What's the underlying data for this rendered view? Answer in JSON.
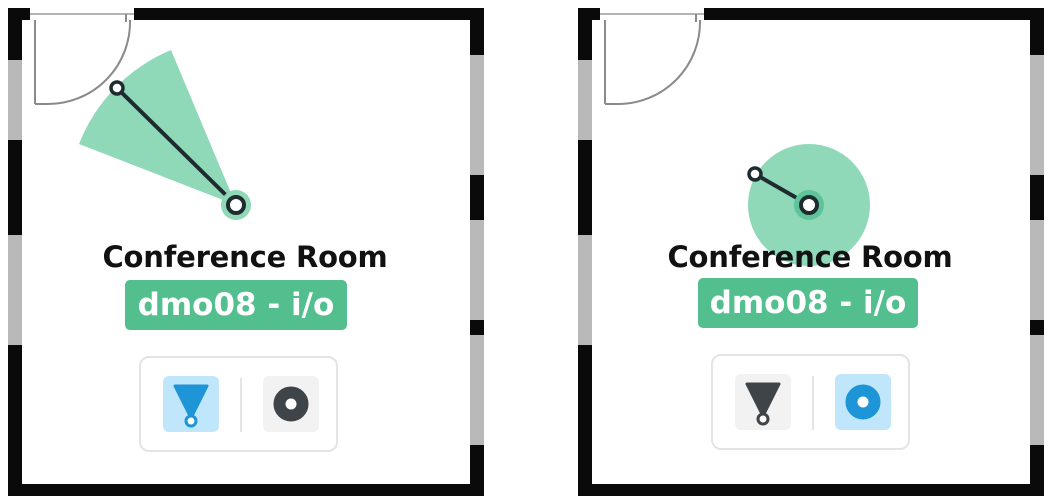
{
  "panels": [
    {
      "id": "left",
      "room_name": "Conference Room",
      "device_label": "dmo08 - i/o",
      "mode": "directional",
      "active_tool": "directional",
      "tools": [
        {
          "name": "directional-tool",
          "icon": "directional-cone-icon"
        },
        {
          "name": "omni-tool",
          "icon": "omni-circle-icon"
        }
      ]
    },
    {
      "id": "right",
      "room_name": "Conference Room",
      "device_label": "dmo08 - i/o",
      "mode": "omni",
      "active_tool": "omni",
      "tools": [
        {
          "name": "directional-tool",
          "icon": "directional-cone-icon"
        },
        {
          "name": "omni-tool",
          "icon": "omni-circle-icon"
        }
      ]
    }
  ],
  "colors": {
    "coverage": "#8fd9b9",
    "coverage_stroke": "#5fc49a",
    "tag_bg": "#53bf8e",
    "wall": "#0a0a0a",
    "window": "#b9b9b9",
    "active_tool_bg": "#bfe6fb",
    "active_tool_icon": "#1d95d6",
    "inactive_tool_bg": "#f2f2f2",
    "inactive_tool_icon": "#3f4449",
    "handle": "#1e2b2f"
  }
}
